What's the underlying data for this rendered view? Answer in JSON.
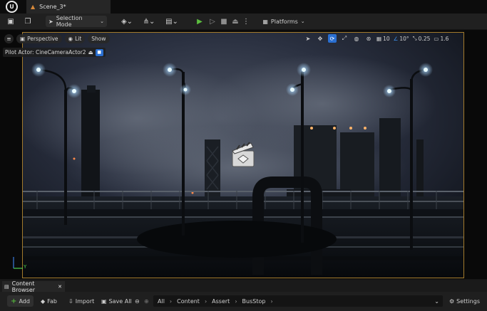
{
  "titlebar": {
    "scene_tab": "Scene_3*"
  },
  "toolbar": {
    "selection_mode": "Selection Mode",
    "platforms": "Platforms"
  },
  "viewport": {
    "perspective": "Perspective",
    "lit": "Lit",
    "show": "Show",
    "grid_snap": "10",
    "angle_snap": "10°",
    "scale_snap": "0.25",
    "camera_speed": "1.6",
    "pilot_label": "Pilot Actor: CineCameraActor2",
    "axis_y": "Y"
  },
  "content_browser": {
    "tab_label": "Content Browser",
    "add": "Add",
    "fab": "Fab",
    "import": "Import",
    "save_all": "Save All",
    "settings": "Settings",
    "path": [
      "All",
      "Content",
      "Assert",
      "BusStop"
    ]
  },
  "colors": {
    "accent_blue": "#2a6fd1",
    "play_green": "#5cbf3f",
    "selection_border": "#a27a2c"
  }
}
